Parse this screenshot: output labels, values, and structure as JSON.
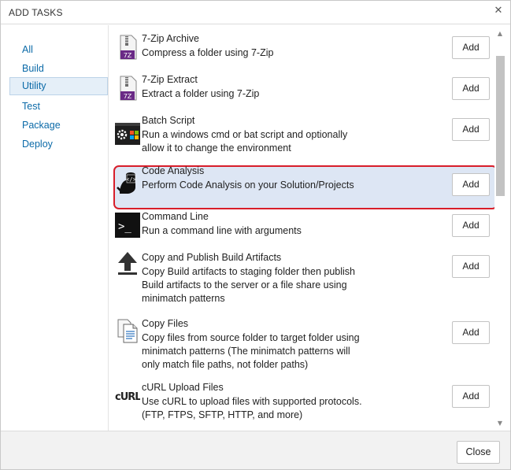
{
  "dialog": {
    "title": "ADD TASKS",
    "close_glyph": "✕",
    "close_button_label": "Close"
  },
  "sidebar": {
    "items": [
      {
        "label": "All",
        "selected": false
      },
      {
        "label": "Build",
        "selected": false
      },
      {
        "label": "Utility",
        "selected": true
      },
      {
        "label": "Test",
        "selected": false
      },
      {
        "label": "Package",
        "selected": false
      },
      {
        "label": "Deploy",
        "selected": false
      }
    ]
  },
  "tasks": [
    {
      "name": "7-Zip Archive",
      "description": "Compress a folder using 7-Zip",
      "icon": "7zip-icon",
      "add_label": "Add"
    },
    {
      "name": "7-Zip Extract",
      "description": "Extract a folder using 7-Zip",
      "icon": "7zip-icon",
      "add_label": "Add"
    },
    {
      "name": "Batch Script",
      "description": "Run a windows cmd or bat script and optionally allow it to change the environment",
      "icon": "batch-script-icon",
      "add_label": "Add"
    },
    {
      "name": "Code Analysis",
      "description": "Perform Code Analysis on your Solution/Projects",
      "icon": "code-analysis-icon",
      "add_label": "Add",
      "highlighted": true
    },
    {
      "name": "Command Line",
      "description": "Run a command line with arguments",
      "icon": "command-line-icon",
      "add_label": "Add"
    },
    {
      "name": "Copy and Publish Build Artifacts",
      "description": "Copy Build artifacts to staging folder then publish Build artifacts to the server or a file share using minimatch patterns",
      "icon": "upload-arrow-icon",
      "add_label": "Add"
    },
    {
      "name": "Copy Files",
      "description": "Copy files from source folder to target folder using minimatch patterns (The minimatch patterns will only match file paths, not folder paths)",
      "icon": "copy-files-icon",
      "add_label": "Add"
    },
    {
      "name": "cURL Upload Files",
      "description": "Use cURL to upload files with supported protocols. (FTP, FTPS, SFTP, HTTP, and more)",
      "icon": "curl-icon",
      "add_label": "Add"
    }
  ],
  "icon_text": {
    "sevenzip": "7Z",
    "command_prompt": ">_",
    "curl": "cURL"
  },
  "colors": {
    "link": "#0b6aa8",
    "highlight_border": "#d81e2a",
    "highlight_fill": "#dde6f4",
    "selected_fill": "#e5eff8"
  }
}
